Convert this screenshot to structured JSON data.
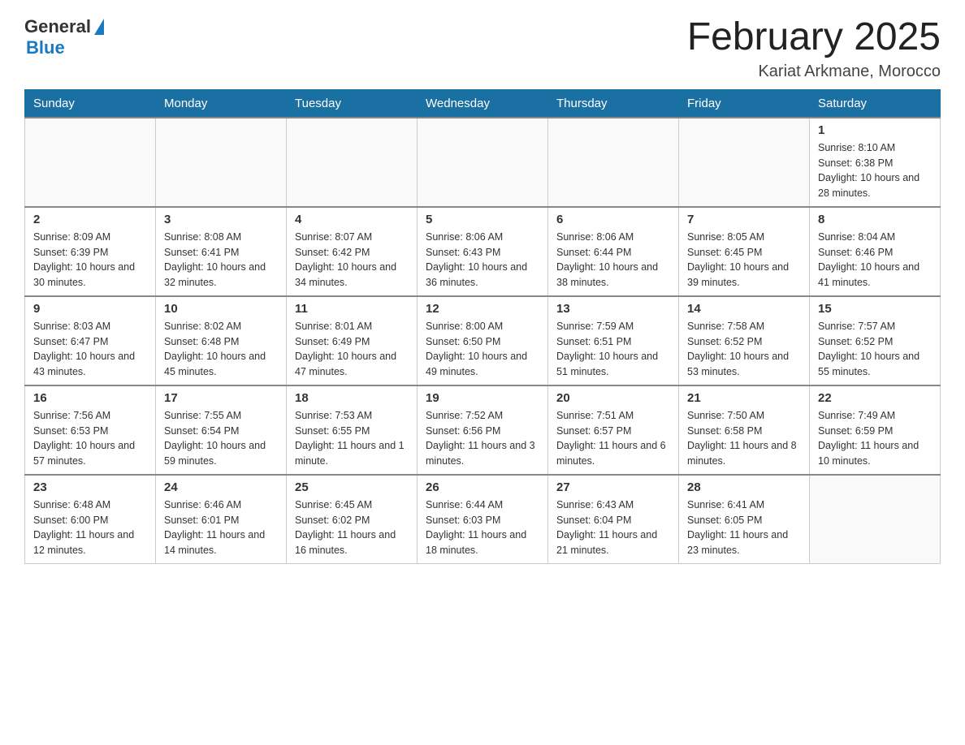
{
  "logo": {
    "general": "General",
    "blue": "Blue"
  },
  "title": "February 2025",
  "location": "Kariat Arkmane, Morocco",
  "weekdays": [
    "Sunday",
    "Monday",
    "Tuesday",
    "Wednesday",
    "Thursday",
    "Friday",
    "Saturday"
  ],
  "weeks": [
    [
      {
        "day": "",
        "info": ""
      },
      {
        "day": "",
        "info": ""
      },
      {
        "day": "",
        "info": ""
      },
      {
        "day": "",
        "info": ""
      },
      {
        "day": "",
        "info": ""
      },
      {
        "day": "",
        "info": ""
      },
      {
        "day": "1",
        "info": "Sunrise: 8:10 AM\nSunset: 6:38 PM\nDaylight: 10 hours and 28 minutes."
      }
    ],
    [
      {
        "day": "2",
        "info": "Sunrise: 8:09 AM\nSunset: 6:39 PM\nDaylight: 10 hours and 30 minutes."
      },
      {
        "day": "3",
        "info": "Sunrise: 8:08 AM\nSunset: 6:41 PM\nDaylight: 10 hours and 32 minutes."
      },
      {
        "day": "4",
        "info": "Sunrise: 8:07 AM\nSunset: 6:42 PM\nDaylight: 10 hours and 34 minutes."
      },
      {
        "day": "5",
        "info": "Sunrise: 8:06 AM\nSunset: 6:43 PM\nDaylight: 10 hours and 36 minutes."
      },
      {
        "day": "6",
        "info": "Sunrise: 8:06 AM\nSunset: 6:44 PM\nDaylight: 10 hours and 38 minutes."
      },
      {
        "day": "7",
        "info": "Sunrise: 8:05 AM\nSunset: 6:45 PM\nDaylight: 10 hours and 39 minutes."
      },
      {
        "day": "8",
        "info": "Sunrise: 8:04 AM\nSunset: 6:46 PM\nDaylight: 10 hours and 41 minutes."
      }
    ],
    [
      {
        "day": "9",
        "info": "Sunrise: 8:03 AM\nSunset: 6:47 PM\nDaylight: 10 hours and 43 minutes."
      },
      {
        "day": "10",
        "info": "Sunrise: 8:02 AM\nSunset: 6:48 PM\nDaylight: 10 hours and 45 minutes."
      },
      {
        "day": "11",
        "info": "Sunrise: 8:01 AM\nSunset: 6:49 PM\nDaylight: 10 hours and 47 minutes."
      },
      {
        "day": "12",
        "info": "Sunrise: 8:00 AM\nSunset: 6:50 PM\nDaylight: 10 hours and 49 minutes."
      },
      {
        "day": "13",
        "info": "Sunrise: 7:59 AM\nSunset: 6:51 PM\nDaylight: 10 hours and 51 minutes."
      },
      {
        "day": "14",
        "info": "Sunrise: 7:58 AM\nSunset: 6:52 PM\nDaylight: 10 hours and 53 minutes."
      },
      {
        "day": "15",
        "info": "Sunrise: 7:57 AM\nSunset: 6:52 PM\nDaylight: 10 hours and 55 minutes."
      }
    ],
    [
      {
        "day": "16",
        "info": "Sunrise: 7:56 AM\nSunset: 6:53 PM\nDaylight: 10 hours and 57 minutes."
      },
      {
        "day": "17",
        "info": "Sunrise: 7:55 AM\nSunset: 6:54 PM\nDaylight: 10 hours and 59 minutes."
      },
      {
        "day": "18",
        "info": "Sunrise: 7:53 AM\nSunset: 6:55 PM\nDaylight: 11 hours and 1 minute."
      },
      {
        "day": "19",
        "info": "Sunrise: 7:52 AM\nSunset: 6:56 PM\nDaylight: 11 hours and 3 minutes."
      },
      {
        "day": "20",
        "info": "Sunrise: 7:51 AM\nSunset: 6:57 PM\nDaylight: 11 hours and 6 minutes."
      },
      {
        "day": "21",
        "info": "Sunrise: 7:50 AM\nSunset: 6:58 PM\nDaylight: 11 hours and 8 minutes."
      },
      {
        "day": "22",
        "info": "Sunrise: 7:49 AM\nSunset: 6:59 PM\nDaylight: 11 hours and 10 minutes."
      }
    ],
    [
      {
        "day": "23",
        "info": "Sunrise: 6:48 AM\nSunset: 6:00 PM\nDaylight: 11 hours and 12 minutes."
      },
      {
        "day": "24",
        "info": "Sunrise: 6:46 AM\nSunset: 6:01 PM\nDaylight: 11 hours and 14 minutes."
      },
      {
        "day": "25",
        "info": "Sunrise: 6:45 AM\nSunset: 6:02 PM\nDaylight: 11 hours and 16 minutes."
      },
      {
        "day": "26",
        "info": "Sunrise: 6:44 AM\nSunset: 6:03 PM\nDaylight: 11 hours and 18 minutes."
      },
      {
        "day": "27",
        "info": "Sunrise: 6:43 AM\nSunset: 6:04 PM\nDaylight: 11 hours and 21 minutes."
      },
      {
        "day": "28",
        "info": "Sunrise: 6:41 AM\nSunset: 6:05 PM\nDaylight: 11 hours and 23 minutes."
      },
      {
        "day": "",
        "info": ""
      }
    ]
  ]
}
